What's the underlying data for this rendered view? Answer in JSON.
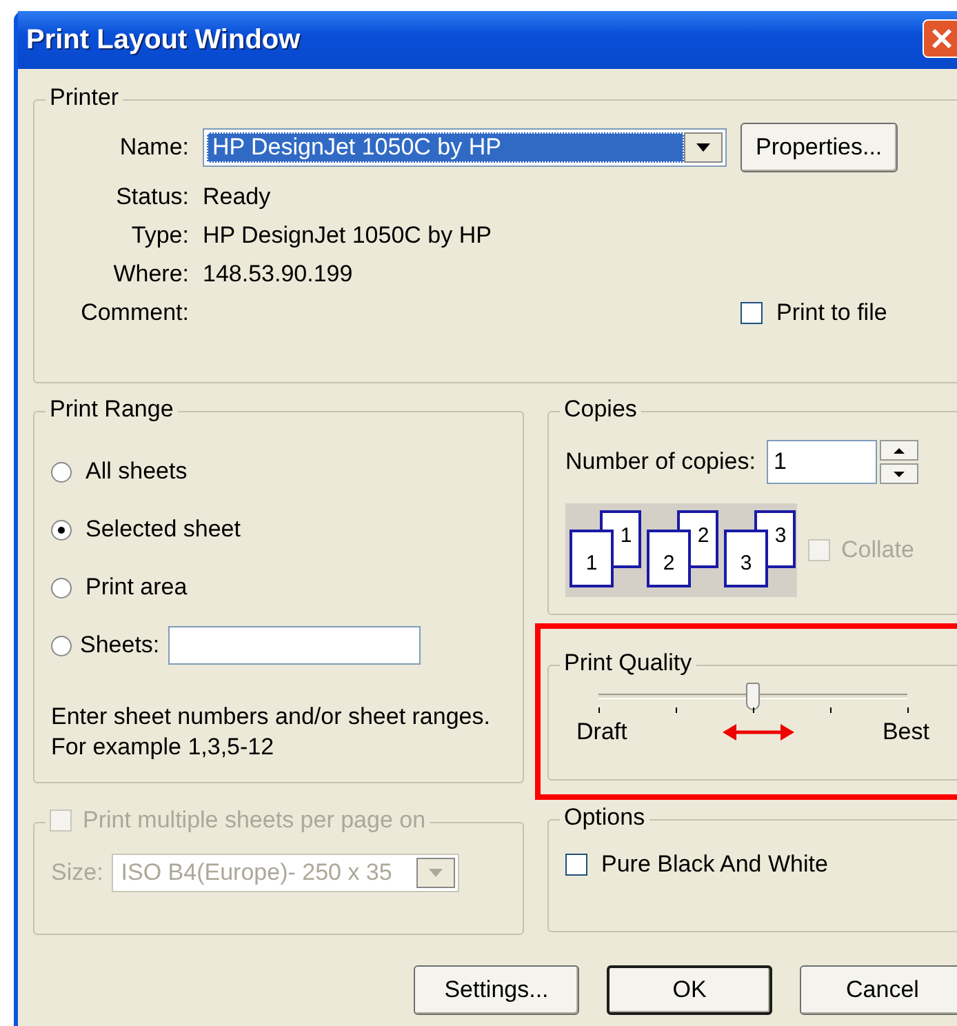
{
  "window": {
    "title": "Print Layout Window"
  },
  "printer": {
    "title": "Printer",
    "fields": [
      {
        "label": "Name:",
        "kind": "select",
        "value": "HP DesignJet 1050C by HP"
      },
      {
        "label": "Status:",
        "kind": "text",
        "value": "Ready"
      },
      {
        "label": "Type:",
        "kind": "text",
        "value": "HP DesignJet 1050C by HP"
      },
      {
        "label": "Where:",
        "kind": "text",
        "value": "148.53.90.199"
      },
      {
        "label": "Comment:",
        "kind": "text"
      }
    ],
    "properties_button": "Properties...",
    "print_to_file": {
      "label": "Print to file",
      "checked": false
    }
  },
  "print_range": {
    "title": "Print Range",
    "options": [
      {
        "label": "All sheets",
        "selected": false,
        "kind": "plain"
      },
      {
        "label": "Selected sheet",
        "selected": true,
        "kind": "plain"
      },
      {
        "label": "Print area",
        "selected": false,
        "kind": "plain"
      },
      {
        "label": "Sheets:",
        "selected": false,
        "kind": "input"
      }
    ],
    "hint": [
      "Enter sheet numbers and/or sheet ranges.",
      "For example 1,3,5-12"
    ]
  },
  "copies": {
    "title": "Copies",
    "label": "Number of copies:",
    "value": "1",
    "pages": [
      {
        "front": "1",
        "back": "1"
      },
      {
        "front": "2",
        "back": "2"
      },
      {
        "front": "3",
        "back": "3"
      }
    ],
    "collate": {
      "label": "Collate",
      "checked": false,
      "disabled": true
    }
  },
  "print_quality": {
    "title": "Print Quality",
    "level": 0.5,
    "min_label": "Draft",
    "max_label": "Best"
  },
  "multiple_sheets": {
    "label": "Print multiple sheets per page on",
    "checked": false,
    "disabled": true,
    "size_label": "Size:",
    "size_value": "ISO B4(Europe)- 250 x 35"
  },
  "options": {
    "title": "Options",
    "items": [
      {
        "label": "Pure Black And White",
        "checked": false
      }
    ]
  },
  "buttons": [
    {
      "label": "Settings...",
      "default": false
    },
    {
      "label": "OK",
      "default": true
    },
    {
      "label": "Cancel",
      "default": false
    }
  ]
}
